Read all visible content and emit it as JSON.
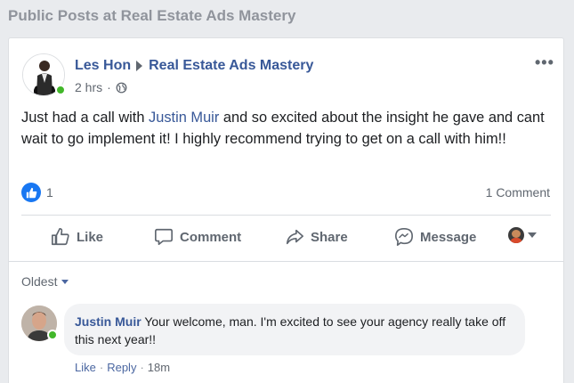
{
  "section_title": "Public Posts at Real Estate Ads Mastery",
  "post": {
    "author": "Les Hon",
    "group": "Real Estate Ads Mastery",
    "time": "2 hrs",
    "privacy_icon": "globe-icon",
    "text_before": "Just had a call with ",
    "mention": "Justin Muir",
    "text_after": " and so excited about the insight he gave and cant wait to go implement it! I highly recommend trying to get on a call with him!!",
    "reaction_count": "1",
    "comment_count": "1 Comment"
  },
  "actions": {
    "like": "Like",
    "comment": "Comment",
    "share": "Share",
    "message": "Message"
  },
  "comments": {
    "sort_label": "Oldest",
    "items": [
      {
        "author": "Justin Muir",
        "text": "Your welcome, man. I'm excited to see your agency really take off this next year!!",
        "like": "Like",
        "reply": "Reply",
        "time": "18m"
      }
    ]
  },
  "colors": {
    "link_blue": "#385898",
    "like_blue": "#1877f2",
    "online_green": "#42b72a"
  }
}
